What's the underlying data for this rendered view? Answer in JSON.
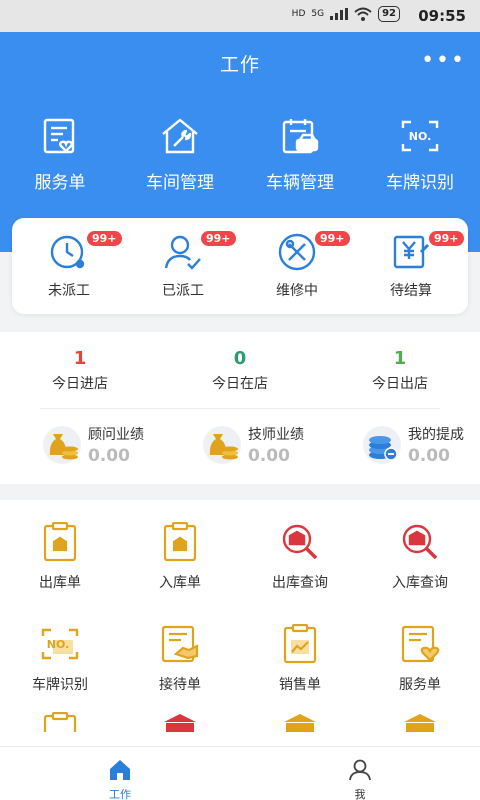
{
  "status_bar": {
    "time": "09:55",
    "battery": "92",
    "network_1": "HD",
    "network_2": "5G"
  },
  "header": {
    "title": "工作",
    "more": "•••"
  },
  "top_nav": [
    {
      "label": "服务单",
      "icon": "service-order-icon"
    },
    {
      "label": "车间管理",
      "icon": "workshop-icon"
    },
    {
      "label": "车辆管理",
      "icon": "vehicle-icon"
    },
    {
      "label": "车牌识别",
      "icon": "plate-scan-icon"
    }
  ],
  "work_status": [
    {
      "label": "未派工",
      "badge": "99+"
    },
    {
      "label": "已派工",
      "badge": "99+"
    },
    {
      "label": "维修中",
      "badge": "99+"
    },
    {
      "label": "待结算",
      "badge": "99+"
    }
  ],
  "counts": [
    {
      "label": "今日进店",
      "value": "1",
      "color": "#e2453c"
    },
    {
      "label": "今日在店",
      "value": "0",
      "color": "#2a9d6e"
    },
    {
      "label": "今日出店",
      "value": "1",
      "color": "#4caf50"
    }
  ],
  "performance": [
    {
      "label": "顾问业绩",
      "value": "0.00"
    },
    {
      "label": "技师业绩",
      "value": "0.00"
    },
    {
      "label": "我的提成",
      "value": "0.00"
    }
  ],
  "grid": {
    "row1": [
      {
        "label": "出库单"
      },
      {
        "label": "入库单"
      },
      {
        "label": "出库查询"
      },
      {
        "label": "入库查询"
      }
    ],
    "row2": [
      {
        "label": "车牌识别"
      },
      {
        "label": "接待单"
      },
      {
        "label": "销售单"
      },
      {
        "label": "服务单"
      }
    ]
  },
  "tabs": [
    {
      "label": "工作",
      "active": true
    },
    {
      "label": "我",
      "active": false
    }
  ],
  "colors": {
    "primary": "#3a8ef0",
    "badge": "#f0454a",
    "gold": "#e0a31c",
    "red_icon": "#d9363e"
  }
}
